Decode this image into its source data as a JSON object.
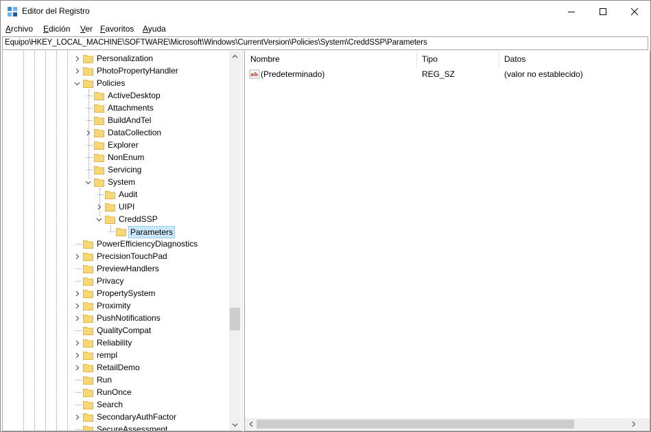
{
  "window": {
    "title": "Editor del Registro"
  },
  "controls": {
    "minimize": "minimize",
    "maximize": "maximize",
    "close": "close"
  },
  "menu": [
    {
      "key": "A",
      "rest": "rchivo"
    },
    {
      "key": "E",
      "rest": "dición"
    },
    {
      "key": "V",
      "rest": "er"
    },
    {
      "key": "F",
      "rest": "avoritos"
    },
    {
      "key": "A",
      "rest": "yuda"
    }
  ],
  "address": {
    "path": "Equipo\\HKEY_LOCAL_MACHINE\\SOFTWARE\\Microsoft\\Windows\\CurrentVersion\\Policies\\System\\CreddSSP\\Parameters"
  },
  "tree": {
    "nodes": [
      {
        "label": "Personalization",
        "expander": "collapsed"
      },
      {
        "label": "PhotoPropertyHandler",
        "expander": "collapsed"
      },
      {
        "label": "Policies",
        "expander": "expanded"
      },
      {
        "label": "ActiveDesktop",
        "expander": "none"
      },
      {
        "label": "Attachments",
        "expander": "none"
      },
      {
        "label": "BuildAndTel",
        "expander": "none"
      },
      {
        "label": "DataCollection",
        "expander": "collapsed"
      },
      {
        "label": "Explorer",
        "expander": "none"
      },
      {
        "label": "NonEnum",
        "expander": "none"
      },
      {
        "label": "Servicing",
        "expander": "none"
      },
      {
        "label": "System",
        "expander": "expanded"
      },
      {
        "label": "Audit",
        "expander": "none"
      },
      {
        "label": "UIPI",
        "expander": "collapsed"
      },
      {
        "label": "CreddSSP",
        "expander": "expanded"
      },
      {
        "label": "Parameters",
        "expander": "none",
        "selected": true
      },
      {
        "label": "PowerEfficiencyDiagnostics",
        "expander": "none"
      },
      {
        "label": "PrecisionTouchPad",
        "expander": "collapsed"
      },
      {
        "label": "PreviewHandlers",
        "expander": "none"
      },
      {
        "label": "Privacy",
        "expander": "none"
      },
      {
        "label": "PropertySystem",
        "expander": "collapsed"
      },
      {
        "label": "Proximity",
        "expander": "collapsed"
      },
      {
        "label": "PushNotifications",
        "expander": "collapsed"
      },
      {
        "label": "QualityCompat",
        "expander": "none"
      },
      {
        "label": "Reliability",
        "expander": "collapsed"
      },
      {
        "label": "rempl",
        "expander": "collapsed"
      },
      {
        "label": "RetailDemo",
        "expander": "collapsed"
      },
      {
        "label": "Run",
        "expander": "none"
      },
      {
        "label": "RunOnce",
        "expander": "none"
      },
      {
        "label": "Search",
        "expander": "none"
      },
      {
        "label": "SecondaryAuthFactor",
        "expander": "collapsed"
      },
      {
        "label": "SecureAssessment",
        "expander": "none"
      }
    ]
  },
  "list": {
    "columns": [
      "Nombre",
      "Tipo",
      "Datos"
    ],
    "rows": [
      {
        "icon": "string-value-icon",
        "name": "(Predeterminado)",
        "type": "REG_SZ",
        "data": "(valor no establecido)"
      }
    ]
  },
  "colors": {
    "selection": "#cce8ff",
    "folder": "#f8d775",
    "folder_dark": "#e4b442",
    "accent": "#2f6fc8"
  }
}
